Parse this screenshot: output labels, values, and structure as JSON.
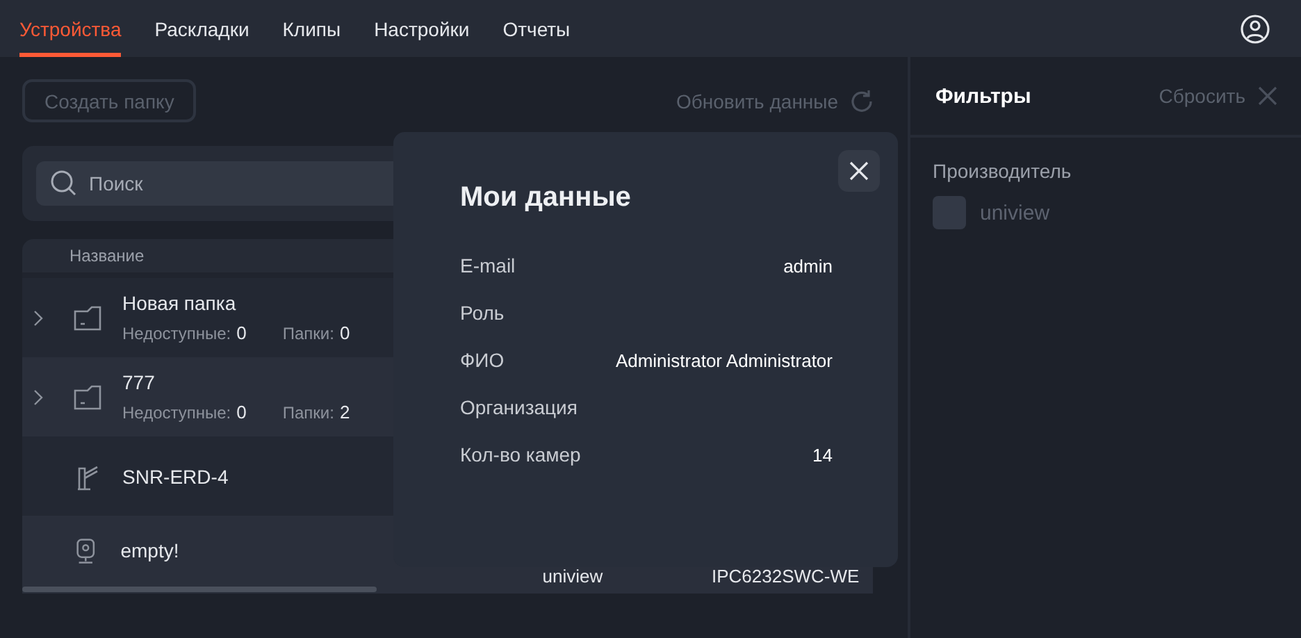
{
  "nav": {
    "tabs": [
      {
        "label": "Устройства",
        "selected": true
      },
      {
        "label": "Раскладки",
        "selected": false
      },
      {
        "label": "Клипы",
        "selected": false
      },
      {
        "label": "Настройки",
        "selected": false
      },
      {
        "label": "Отчеты",
        "selected": false
      }
    ]
  },
  "toolbar": {
    "create_folder": {
      "label": "Создать папку",
      "disabled": true
    },
    "refresh": {
      "label": "Обновить данные",
      "disabled": true
    }
  },
  "search": {
    "placeholder": "Поиск"
  },
  "table": {
    "columns": [
      "Название"
    ],
    "rows": [
      {
        "kind": "folder",
        "name": "Новая папка",
        "unavailable_label": "Недоступные:",
        "unavailable": "0",
        "folders_label": "Папки:",
        "folders": "0"
      },
      {
        "kind": "folder",
        "name": "777",
        "unavailable_label": "Недоступные:",
        "unavailable": "0",
        "folders_label": "Папки:",
        "folders": "2"
      },
      {
        "kind": "barrier",
        "name": "SNR-ERD-4"
      },
      {
        "kind": "camera",
        "name": "empty!",
        "manufacturer": "uniview",
        "model": "IPC6232SWC-WE"
      }
    ]
  },
  "filters": {
    "title": "Фильтры",
    "reset": {
      "label": "Сбросить",
      "disabled": true
    },
    "sections": [
      {
        "title": "Производитель",
        "options": [
          {
            "label": "uniview",
            "checked": false
          }
        ]
      }
    ]
  },
  "modal": {
    "title": "Мои данные",
    "fields": [
      {
        "label": "E-mail",
        "value": "admin"
      },
      {
        "label": "Роль"
      },
      {
        "label": "ФИО",
        "value": "Administrator Administrator"
      },
      {
        "label": "Организация"
      },
      {
        "label": "Кол-во камер",
        "value": "14"
      }
    ]
  }
}
